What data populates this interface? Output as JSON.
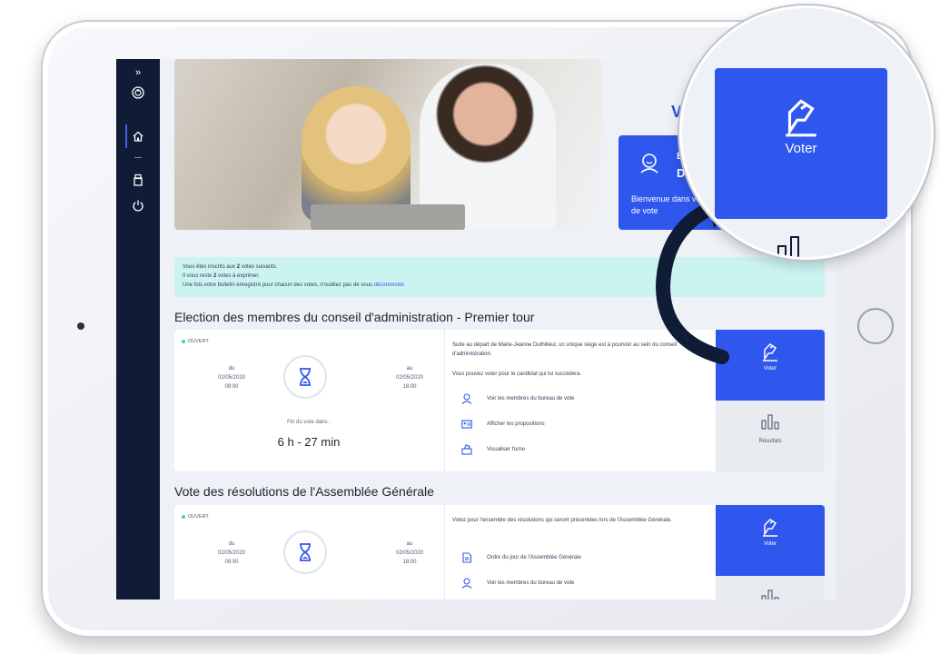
{
  "sidebar": {
    "expand_glyph": "»",
    "items": [
      {
        "icon": "power-circle-icon"
      },
      {
        "icon": "home-icon"
      },
      {
        "icon": "ballot-box-icon"
      },
      {
        "icon": "logout-icon"
      }
    ]
  },
  "welcome": {
    "title_partial": "V",
    "name_line1": "E",
    "name_line2": "D",
    "text": "Bienvenue dans votre espace de vote"
  },
  "banner": {
    "line1_prefix": "Vous êtes inscrits aux ",
    "line1_count": "2",
    "line1_suffix": " votes suivants.",
    "line2_prefix": "Il vous reste ",
    "line2_count": "2",
    "line2_suffix": " votes à exprimer.",
    "line3_prefix": "Une fois votre bulletin enregistré pour chacun des votes, n'oubliez pas de vous ",
    "line3_link": "déconnecter",
    "line3_suffix": "."
  },
  "votes": [
    {
      "title": "Election des membres du conseil d'administration - Premier tour",
      "status": "OUVERT",
      "start_label": "du",
      "start_date": "02/05/2020",
      "start_time": "09:00",
      "end_label": "au",
      "end_date": "02/05/2020",
      "end_time": "18:00",
      "countdown_label": "Fin du vote dans :",
      "countdown": "6 h - 27 min",
      "description": "Suite au départ de Marie-Jeanne Duthilleul, un unique siège est à pourvoir au sein du conseil d'administration.",
      "description2": "Vous pouvez voter pour le candidat qui lui succèdera.",
      "links": [
        {
          "label": "Voir les membres du bureau de vote",
          "icon": "user-icon"
        },
        {
          "label": "Afficher les propositions",
          "icon": "id-card-icon"
        },
        {
          "label": "Visualiser l'urne",
          "icon": "ballot-box-icon"
        }
      ],
      "vote_label": "Voter",
      "results_label": "Résultats"
    },
    {
      "title": "Vote des résolutions de l'Assemblée Générale",
      "status": "OUVERT",
      "start_label": "du",
      "start_date": "02/05/2020",
      "start_time": "09:00",
      "end_label": "au",
      "end_date": "02/05/2020",
      "end_time": "18:00",
      "description": "Votez pour l'ensemble des résolutions qui seront présentées lors de l'Assemblée Générale.",
      "links": [
        {
          "label": "Ordre du jour de l'Assemblée Générale",
          "icon": "document-icon"
        },
        {
          "label": "Voir les membres du bureau de vote",
          "icon": "user-icon"
        }
      ],
      "vote_label": "Voter"
    }
  ],
  "magnifier": {
    "vote_label": "Voter"
  },
  "colors": {
    "sidebar": "#101b36",
    "accent": "#2f57ee",
    "banner": "#cbf4f1",
    "status_dot": "#3cd4c4"
  }
}
